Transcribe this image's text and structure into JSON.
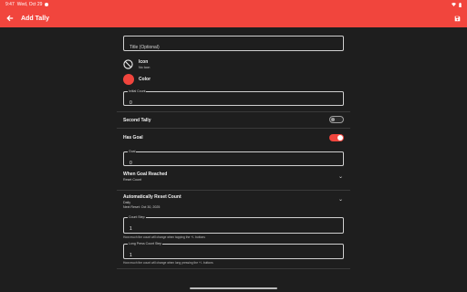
{
  "status_bar": {
    "time": "9:47",
    "date": "Wed, Oct 29"
  },
  "app_bar": {
    "title": "Add Tally",
    "back_icon": "arrow-left-icon",
    "save_icon": "save-icon"
  },
  "form": {
    "title_field": {
      "placeholder": "Title (Optional)",
      "value": ""
    },
    "icon_row": {
      "label": "Icon",
      "value": "No Icon",
      "icon": "block-icon"
    },
    "color_row": {
      "label": "Color",
      "swatch": "#f1453d"
    },
    "initial_count": {
      "label": "Initial Count",
      "value": "0"
    },
    "second_tally": {
      "label": "Second Tally",
      "enabled": false
    },
    "has_goal": {
      "label": "Has Goal",
      "enabled": true
    },
    "goal": {
      "label": "Goal",
      "value": "0"
    },
    "when_goal_reached": {
      "label": "When Goal Reached",
      "value": "Reset Count"
    },
    "auto_reset": {
      "label": "Automatically Reset Count",
      "frequency": "Daily",
      "next_reset": "Next Reset: Oct 30, 2025"
    },
    "count_step": {
      "label": "Count Step",
      "value": "1",
      "helper": "How much the count will change when tapping the +/- buttons"
    },
    "long_press_step": {
      "label": "Long Press Count Step",
      "value": "1",
      "helper": "How much the count will change when long pressing the +/- buttons"
    }
  },
  "colors": {
    "accent": "#f1453d",
    "background": "#1e1e1e"
  }
}
